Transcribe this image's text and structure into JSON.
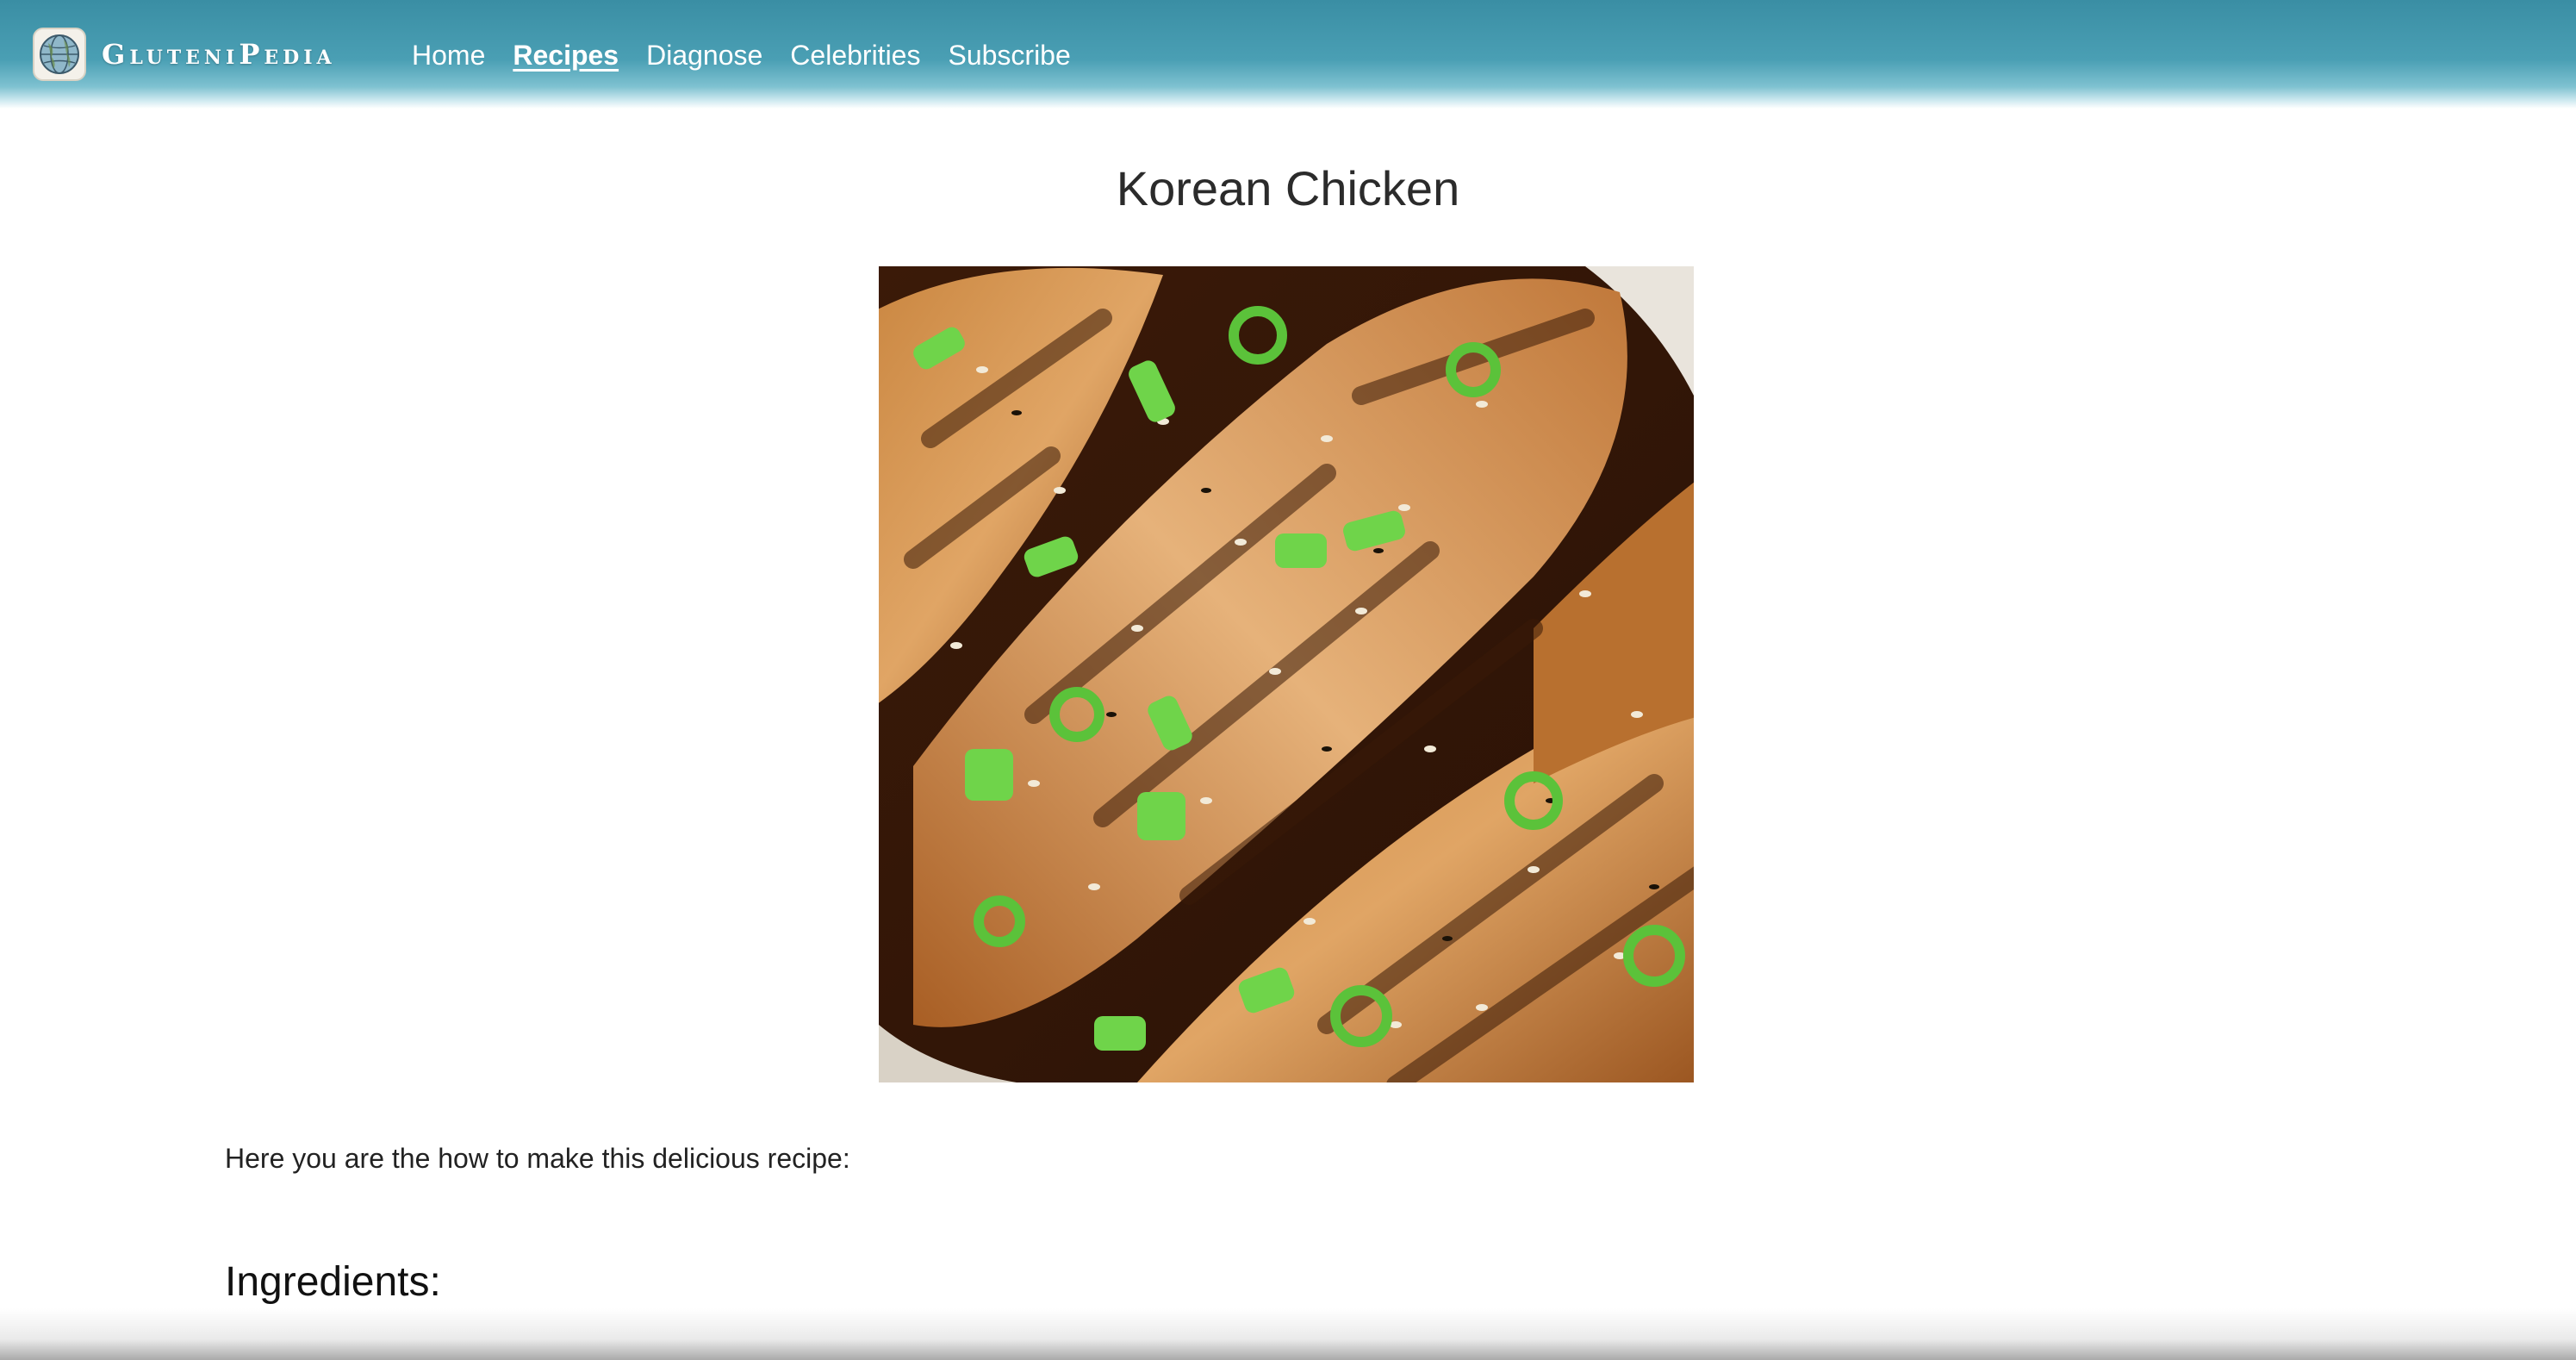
{
  "site": {
    "name": "GluteniPedia",
    "logo_icon": "globe-icon"
  },
  "nav": {
    "items": [
      {
        "label": "Home",
        "active": false
      },
      {
        "label": "Recipes",
        "active": true
      },
      {
        "label": "Diagnose",
        "active": false
      },
      {
        "label": "Celebrities",
        "active": false
      },
      {
        "label": "Subscribe",
        "active": false
      }
    ]
  },
  "recipe": {
    "title": "Korean Chicken",
    "image_subject": "grilled chicken with sesame seeds and green onions",
    "intro": "Here you are the how to make this delicious recipe:",
    "ingredients_heading": "Ingredients:"
  },
  "colors": {
    "header": "#4a9fb4",
    "text": "#222222",
    "nav_text": "#ffffff"
  }
}
